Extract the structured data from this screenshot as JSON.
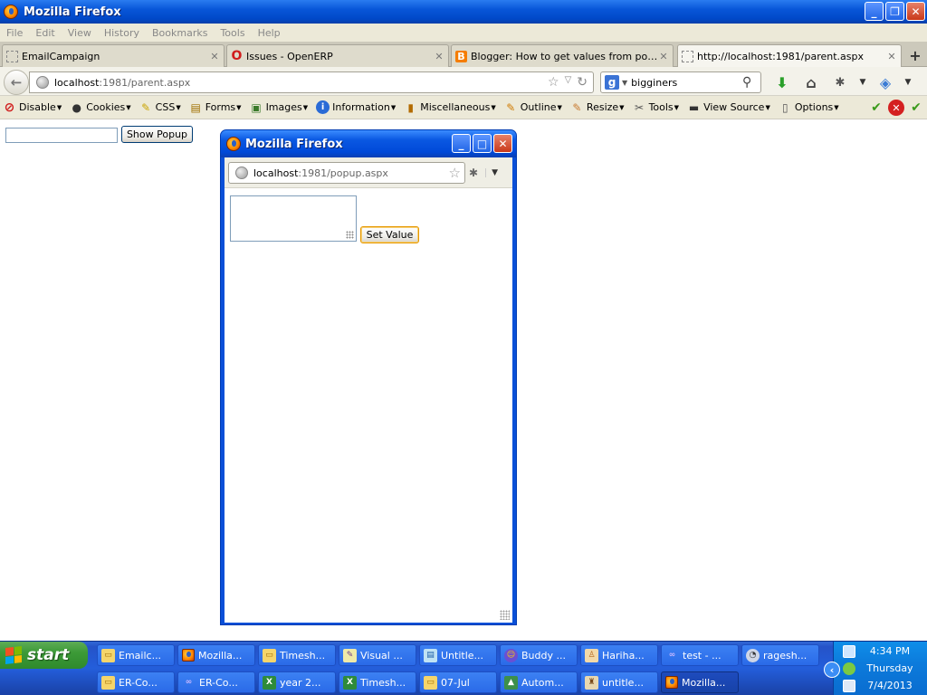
{
  "window": {
    "title": "Mozilla Firefox"
  },
  "menu": [
    "File",
    "Edit",
    "View",
    "History",
    "Bookmarks",
    "Tools",
    "Help"
  ],
  "tabs": [
    {
      "label": "EmailCampaign",
      "icon": "blank-page-icon"
    },
    {
      "label": "Issues - OpenERP",
      "icon": "opera-icon"
    },
    {
      "label": "Blogger: How to get values from popup ...",
      "icon": "blogger-icon"
    },
    {
      "label": "http://localhost:1981/parent.aspx",
      "icon": "blank-page-icon",
      "active": true
    }
  ],
  "navbar": {
    "url_host": "localhost",
    "url_path": ":1981/parent.aspx",
    "search_value": "bigginers"
  },
  "webdev": {
    "items": [
      "Disable",
      "Cookies",
      "CSS",
      "Forms",
      "Images",
      "Information",
      "Miscellaneous",
      "Outline",
      "Resize",
      "Tools",
      "View Source",
      "Options"
    ]
  },
  "page": {
    "input_value": "",
    "show_popup_label": "Show Popup"
  },
  "popup": {
    "title": "Mozilla Firefox",
    "url_host": "localhost",
    "url_path": ":1981/popup.aspx",
    "textarea_value": "",
    "set_value_label": "Set Value"
  },
  "taskbar": {
    "start_label": "start",
    "row1": [
      "Emailc...",
      "Mozilla...",
      "Timesh...",
      "Visual ...",
      "Untitle...",
      "Buddy ...",
      "Hariha...",
      "test - ...",
      "ragesh..."
    ],
    "row2": [
      "ER-Co...",
      "ER-Co...",
      "year 2...",
      "Timesh...",
      "07-Jul",
      "Autom...",
      "untitle...",
      "Mozilla..."
    ],
    "clock_time": "4:34 PM",
    "clock_day": "Thursday",
    "clock_date": "7/4/2013"
  }
}
